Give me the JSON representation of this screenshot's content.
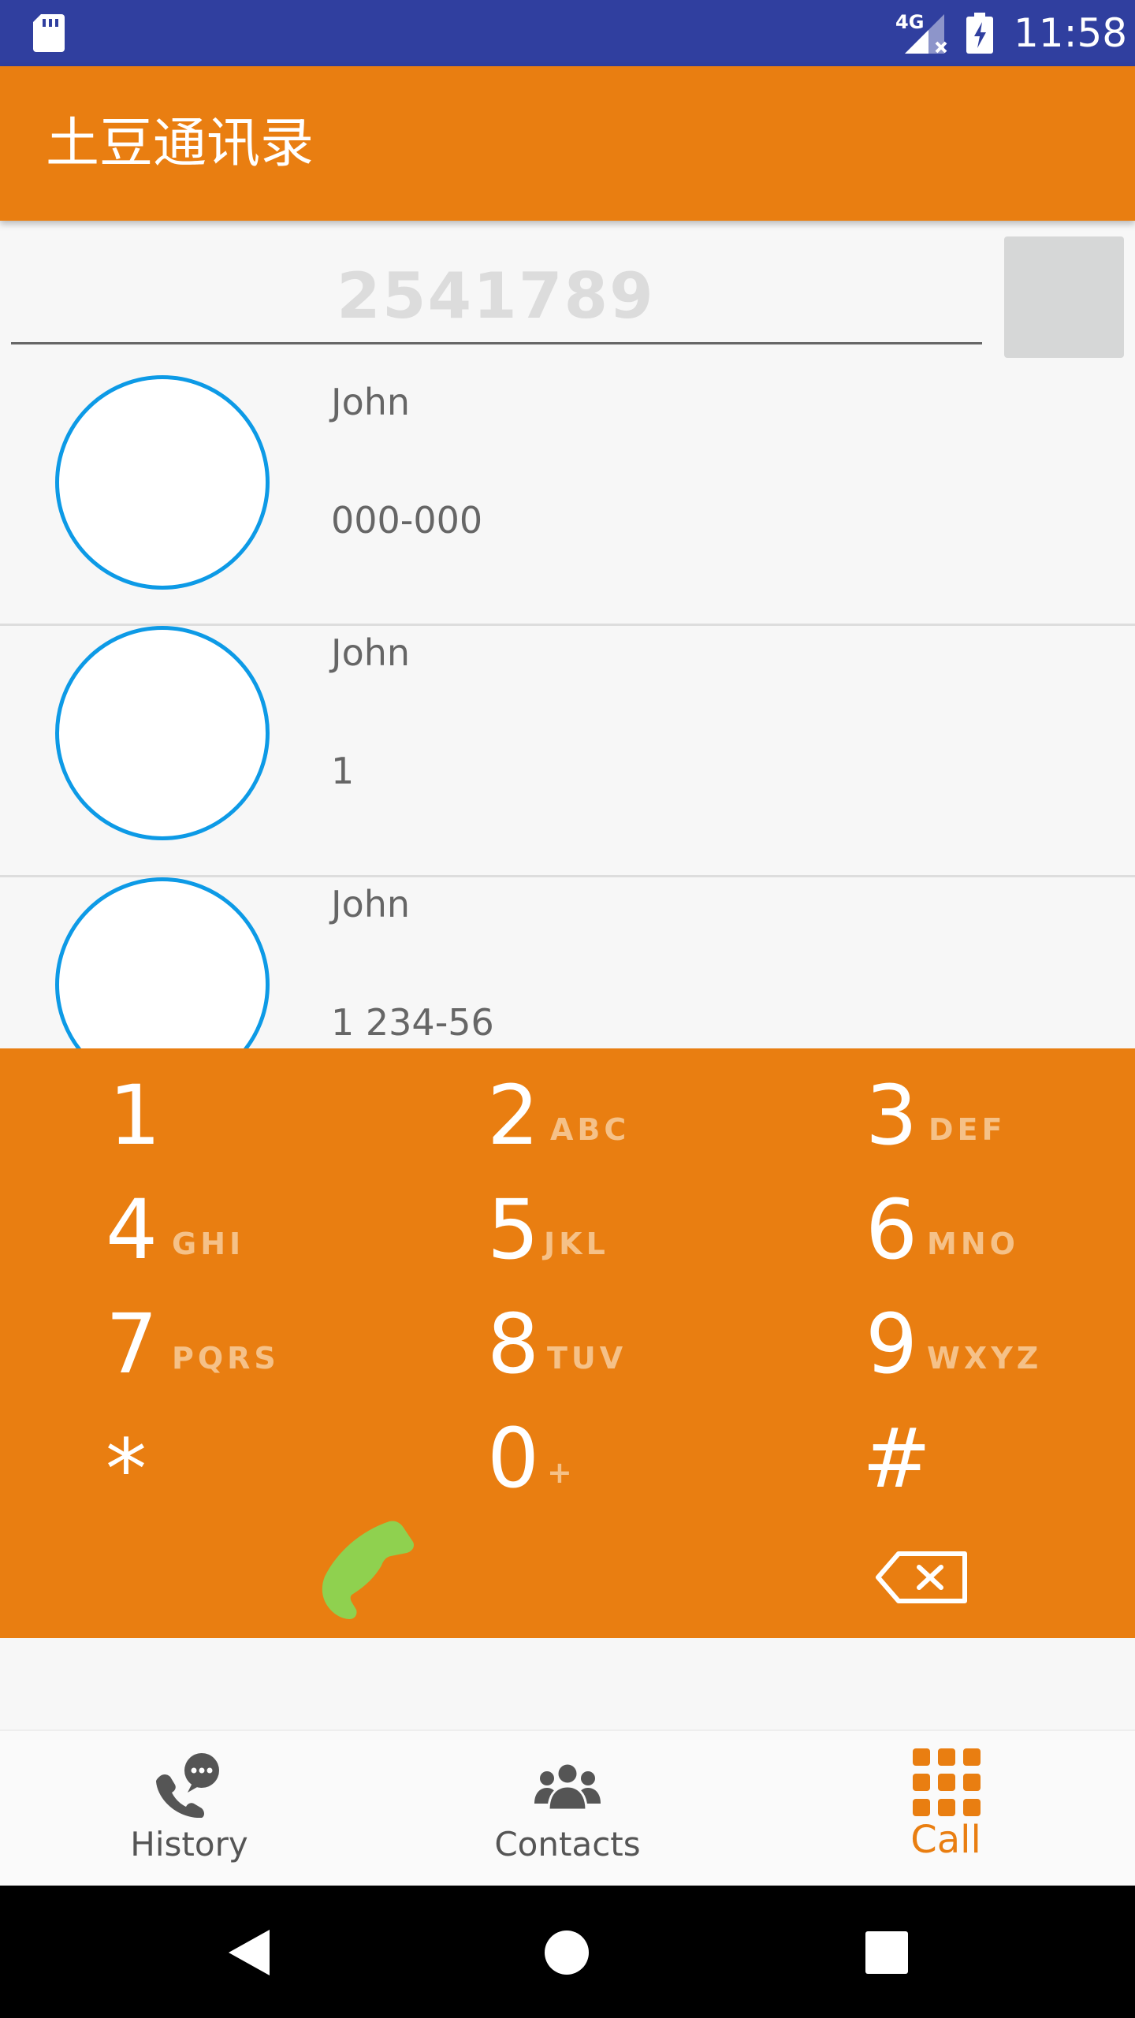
{
  "status_bar": {
    "network": "4G",
    "time": "11:58"
  },
  "app_bar": {
    "title": "土豆通讯录"
  },
  "dial_input": {
    "value": "2541789"
  },
  "contacts": [
    {
      "name": "John",
      "phone": "000-000"
    },
    {
      "name": "John",
      "phone": "1"
    },
    {
      "name": "John",
      "phone": "1 234-56"
    }
  ],
  "keypad": [
    {
      "digit": "1",
      "letters": ""
    },
    {
      "digit": "2",
      "letters": "ABC"
    },
    {
      "digit": "3",
      "letters": "DEF"
    },
    {
      "digit": "4",
      "letters": "GHI"
    },
    {
      "digit": "5",
      "letters": "JKL"
    },
    {
      "digit": "6",
      "letters": "MNO"
    },
    {
      "digit": "7",
      "letters": "PQRS"
    },
    {
      "digit": "8",
      "letters": "TUV"
    },
    {
      "digit": "9",
      "letters": "WXYZ"
    },
    {
      "digit": "*",
      "letters": ""
    },
    {
      "digit": "0",
      "letters": "+"
    },
    {
      "digit": "#",
      "letters": ""
    }
  ],
  "bottom_nav": {
    "items": [
      {
        "label": "History",
        "icon": "phone-chat-icon",
        "active": false
      },
      {
        "label": "Contacts",
        "icon": "group-icon",
        "active": false
      },
      {
        "label": "Call",
        "icon": "dialpad-grid-icon",
        "active": true
      }
    ]
  },
  "colors": {
    "primary": "#e97e11",
    "status_bar": "#303f9f",
    "avatar_ring": "#0d9ae6",
    "call_green": "#8fd14f",
    "nav_inactive": "#555555"
  }
}
